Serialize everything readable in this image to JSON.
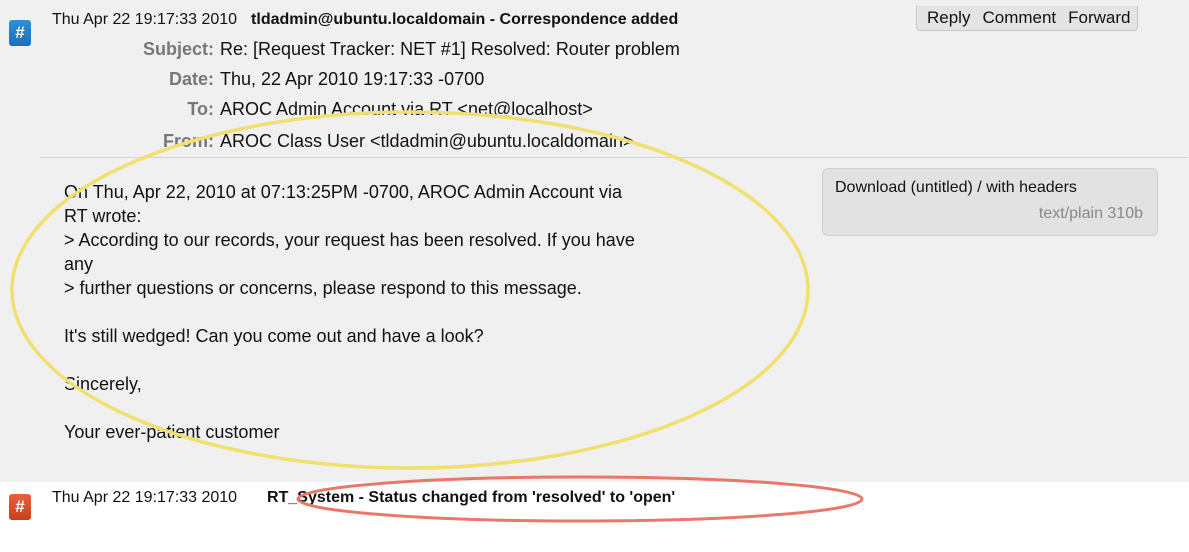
{
  "transactions": [
    {
      "timestamp": "Thu Apr 22 19:17:33 2010",
      "description": "tldadmin@ubuntu.localdomain - Correspondence added",
      "actions": [
        "Reply",
        "Comment",
        "Forward"
      ],
      "headers": {
        "subject_label": "Subject:",
        "subject": "Re: [Request Tracker: NET #1] Resolved: Router problem",
        "date_label": "Date:",
        "date": "Thu, 22 Apr 2010 19:17:33 -0700",
        "to_label": "To:",
        "to": "AROC Admin Account via RT <net@localhost>",
        "from_label": "From:",
        "from": "AROC Class User <tldadmin@ubuntu.localdomain>"
      },
      "body_lines": [
        "On Thu, Apr 22, 2010 at 07:13:25PM -0700, AROC Admin Account via",
        "RT wrote:",
        "> According to our records, your request has been resolved. If you have",
        "any",
        "> further questions or concerns, please respond to this message.",
        "",
        "It's still wedged! Can you come out and have a look?",
        "",
        "Sincerely,",
        "",
        "Your ever-patient customer"
      ],
      "download": {
        "label": "Download (untitled) / with headers",
        "info": "text/plain 310b"
      }
    },
    {
      "timestamp": "Thu Apr 22 19:17:33 2010",
      "description": "RT_System - Status changed from 'resolved' to 'open'"
    }
  ],
  "badge_symbol": "#",
  "colors": {
    "badge_correspondence": "#1a6fb8",
    "badge_status": "#d9502c",
    "highlight_yellow": "#f0e070",
    "highlight_red": "#e8786a"
  }
}
